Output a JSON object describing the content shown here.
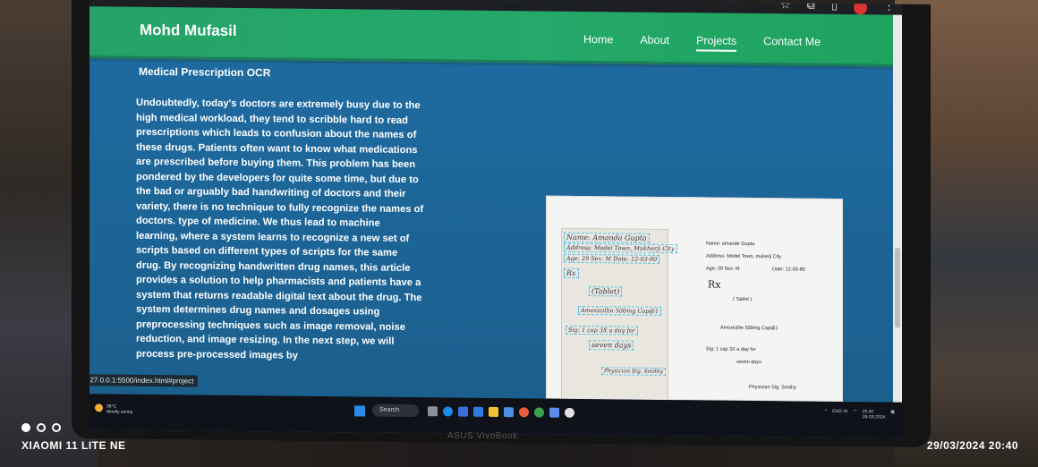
{
  "navbar": {
    "brand": "Mohd Mufasil",
    "links": [
      "Home",
      "About",
      "Projects",
      "Contact Me"
    ]
  },
  "section": {
    "title": "Medical Prescription OCR",
    "description": "Undoubtedly, today's doctors are extremely busy due to the high medical workload, they tend to scribble hard to read prescriptions which leads to confusion about the names of these drugs. Patients often want to know what medications are prescribed before buying them. This problem has been pondered by the developers for quite some time, but due to the bad or arguably bad handwriting of doctors and their variety, there is no technique to fully recognize the names of doctors. type of medicine. We thus lead to machine learning, where a system learns to recognize a new set of scripts based on different types of scripts for the same drug. By recognizing handwritten drug names, this article provides a solution to help pharmacists and patients have a system that returns readable digital text about the drug. The system determines drug names and dosages using preprocessing techniques such as image removal, noise reduction, and image resizing. In the next step, we will process pre-processed images by"
  },
  "figure": {
    "handwritten": [
      "Name: Amanda Gupta",
      "Address: Model Town, Mukherji City",
      "Age: 29  Sex: M  Date: 12-03-80",
      "Rx",
      "(Tablet)",
      "Amoxicillin 500mg Cap@1",
      "Sig: 1 cap 3X a day for",
      "seven days",
      "Physician Sig. Smithy"
    ],
    "digital": [
      "Name: amande Gupta",
      "Address: Model Town, mukerji City",
      "Age: 29 Sex: M",
      "Date: 12-03-80",
      "Rx",
      "( Tablet )",
      "Amoxicillin 500mg Cap@1",
      "Sig: 1 cap 3X a day for",
      "seven days",
      "Physician Sig. Smithy"
    ]
  },
  "status_url": "127.0.0.1:5500/index.html#project",
  "taskbar": {
    "weather_temp": "36°C",
    "weather_desc": "Mostly sunny",
    "search_label": "Search",
    "lang": "ENG IN",
    "time": "20:40",
    "date": "29-03-2024"
  },
  "laptop_brand": "ASUS VivoBook",
  "photo_watermark": {
    "device": "XIAOMI 11 LITE NE",
    "datetime": "29/03/2024  20:40"
  }
}
